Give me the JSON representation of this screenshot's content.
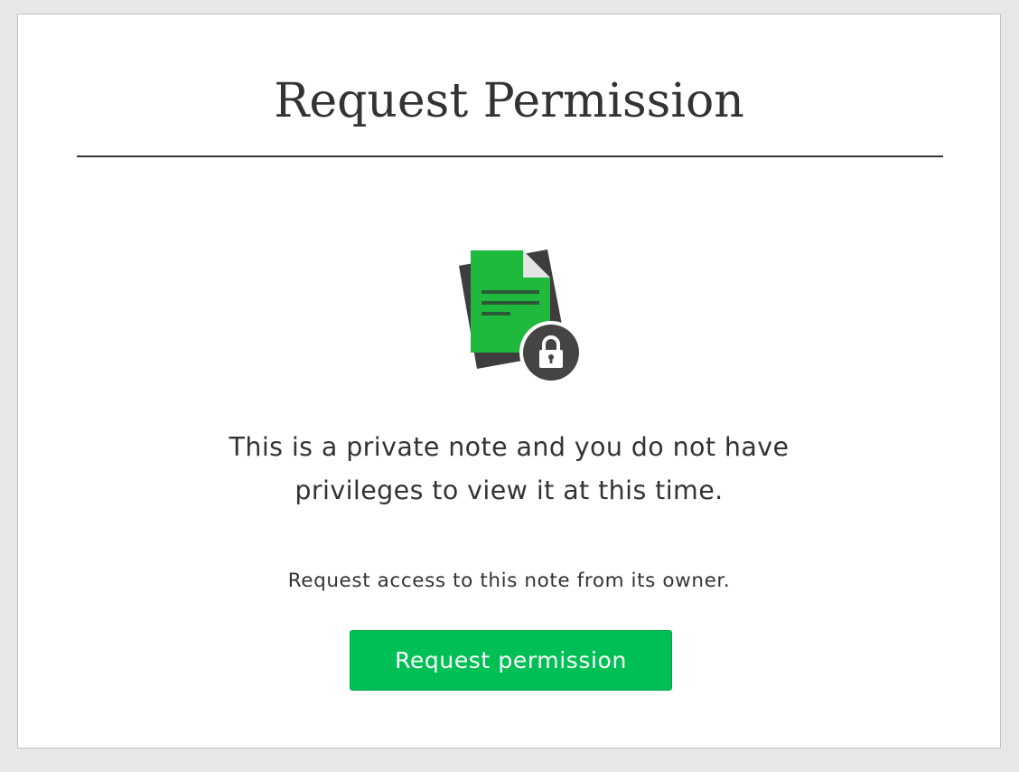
{
  "dialog": {
    "title": "Request Permission",
    "message_line1": "This is a private note and you do not have",
    "message_line2": "privileges to view it at this time.",
    "subtext": "Request access to this note from its owner.",
    "button_label": "Request permission"
  },
  "icons": {
    "document": "private-note-icon",
    "lock": "lock-icon"
  },
  "colors": {
    "accent": "#00c055",
    "note_green": "#1fba3d",
    "dark": "#333333"
  }
}
